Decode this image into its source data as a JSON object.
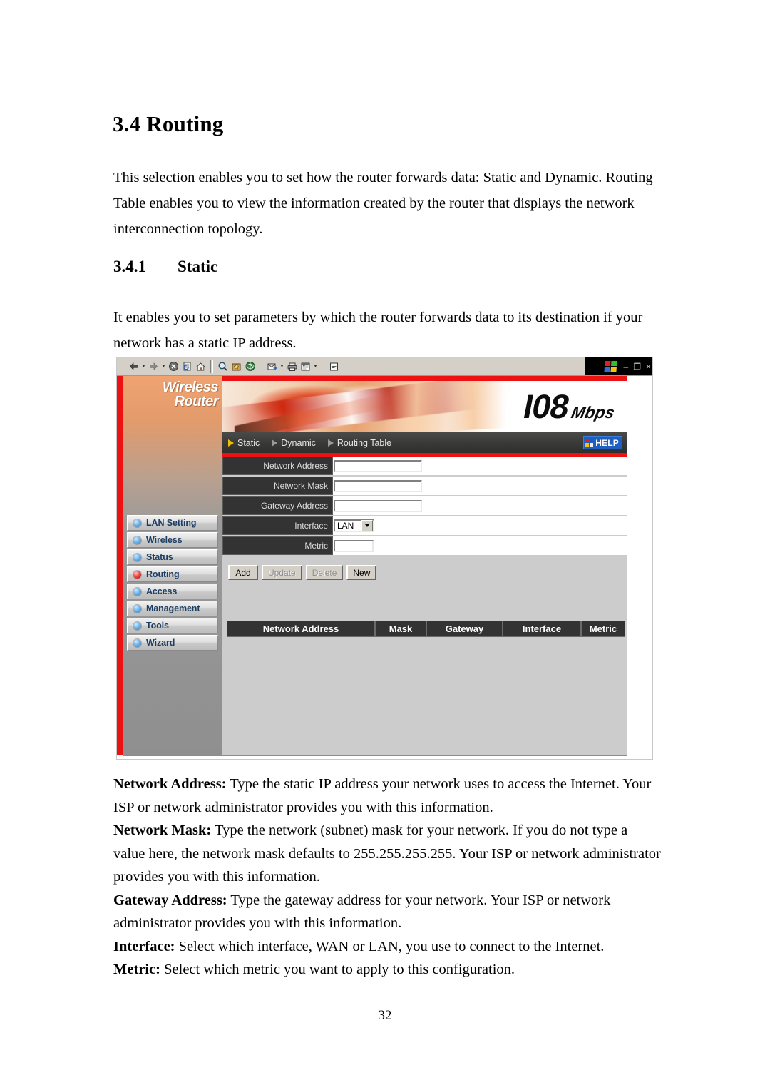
{
  "document": {
    "heading": "3.4 Routing",
    "intro": "This selection enables you to set how the router forwards data: Static and Dynamic. Routing Table enables you to view the information created by the router that displays the network interconnection topology.",
    "subheading_number": "3.4.1",
    "subheading_title": "Static",
    "static_intro": "It enables you to set parameters by which the router forwards data to its destination if your network has a static IP address.",
    "descriptions": [
      {
        "term": "Network Address:",
        "text": " Type the static IP address your network uses to access the Internet. Your ISP or network administrator provides you with this information."
      },
      {
        "term": "Network Mask:",
        "text": " Type the network (subnet) mask for your network. If you do not type a value here, the network mask defaults to 255.255.255.255. Your ISP or network administrator provides you with this information."
      },
      {
        "term": "Gateway Address:",
        "text": " Type the gateway address for your network. Your ISP or network administrator provides you with this information."
      },
      {
        "term": "Interface:",
        "text": " Select which interface, WAN or LAN, you use to connect to the Internet."
      },
      {
        "term": "Metric:",
        "text": " Select which metric you want to apply to this configuration."
      }
    ],
    "page_number": "32"
  },
  "screenshot": {
    "window_controls": {
      "minimize": "–",
      "restore": "❐",
      "close": "×"
    },
    "toolbar_icons": [
      "back-icon",
      "back-dropdown-icon",
      "forward-icon",
      "forward-dropdown-icon",
      "stop-icon",
      "refresh-icon",
      "home-icon",
      "search-icon",
      "favorites-icon",
      "history-icon",
      "mail-icon",
      "mail-dropdown-icon",
      "print-icon",
      "edit-icon",
      "edit-dropdown-icon",
      "discuss-icon"
    ],
    "brand": {
      "line1": "Wireless",
      "line2": "Router"
    },
    "banner": {
      "speed_number": "I08",
      "speed_unit": "Mbps"
    },
    "nav": {
      "items": [
        {
          "label": "Static",
          "active": true
        },
        {
          "label": "Dynamic",
          "active": false
        },
        {
          "label": "Routing Table",
          "active": false
        }
      ],
      "help_label": "HELP"
    },
    "sidebar": {
      "items": [
        {
          "label": "LAN Setting",
          "active": false
        },
        {
          "label": "Wireless",
          "active": false
        },
        {
          "label": "Status",
          "active": false
        },
        {
          "label": "Routing",
          "active": true
        },
        {
          "label": "Access",
          "active": false
        },
        {
          "label": "Management",
          "active": false
        },
        {
          "label": "Tools",
          "active": false
        },
        {
          "label": "Wizard",
          "active": false
        }
      ]
    },
    "form": {
      "fields": [
        {
          "label": "Network Address",
          "value": "",
          "type": "text"
        },
        {
          "label": "Network Mask",
          "value": "",
          "type": "text"
        },
        {
          "label": "Gateway Address",
          "value": "",
          "type": "text"
        },
        {
          "label": "Interface",
          "value": "LAN",
          "type": "select"
        },
        {
          "label": "Metric",
          "value": "",
          "type": "text-short"
        }
      ],
      "buttons": [
        {
          "label": "Add",
          "enabled": true
        },
        {
          "label": "Update",
          "enabled": false
        },
        {
          "label": "Delete",
          "enabled": false
        },
        {
          "label": "New",
          "enabled": true
        }
      ]
    },
    "table": {
      "columns": [
        "Network Address",
        "Mask",
        "Gateway",
        "Interface",
        "Metric"
      ],
      "rows": []
    },
    "colors": {
      "accent_red": "#ee1111",
      "header_dark": "#333333",
      "help_blue": "#1f5fbf",
      "panel_gray": "#cccccc",
      "active_bullet": "#c00000"
    }
  }
}
